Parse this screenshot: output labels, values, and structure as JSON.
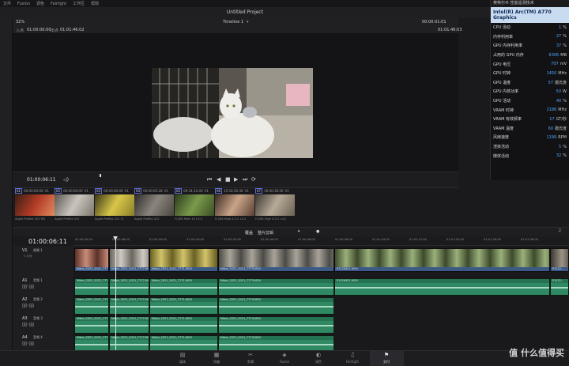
{
  "menubar": {
    "items": [
      "文件",
      "Fusion",
      "调色",
      "Fairlight",
      "工作区",
      "帮助"
    ]
  },
  "window": {
    "title": "Untitled Project"
  },
  "viewer_header": {
    "zoom": "32%",
    "timeline_name": "Timeline 1",
    "src_label": "入点",
    "src_tc": "01:00:00:00",
    "out_label": "出点",
    "out_tc": "01:01:46:02",
    "duration_tc": "00:00:01:01",
    "right_tc": "01:01:46:03"
  },
  "transport": {
    "timecode": "01:00:06:11",
    "controls": [
      "⏮",
      "◀",
      "■",
      "▶",
      "⏭",
      "⟳"
    ]
  },
  "clips": [
    {
      "num": "01",
      "tc": "00:00:00:00",
      "track": "V1",
      "label": "Apple ProRes 422 HQ",
      "colors": [
        "#3b1d16",
        "#b23b26",
        "#e28a5f"
      ]
    },
    {
      "num": "02",
      "tc": "00:00:00:00",
      "track": "V1",
      "label": "Apple ProRes 422",
      "colors": [
        "#5a5752",
        "#c9c5bd",
        "#7b766e"
      ]
    },
    {
      "num": "03",
      "tc": "00:00:00:00",
      "track": "V1",
      "label": "Apple ProRes 422 LT",
      "colors": [
        "#3a3616",
        "#d8c64a",
        "#8b7f2a"
      ]
    },
    {
      "num": "04",
      "tc": "00:00:05:28",
      "track": "V1",
      "label": "Apple ProRes 422",
      "colors": [
        "#2c2b29",
        "#8a857c",
        "#4a4741"
      ]
    },
    {
      "num": "05",
      "tc": "09:34:12:46",
      "track": "V1",
      "label": "H.265 Main 10 L5.2",
      "colors": [
        "#2c3a1c",
        "#7a9a4a",
        "#3c4e24"
      ]
    },
    {
      "num": "06",
      "tc": "15:54:56:36",
      "track": "V1",
      "label": "H.264 High 4:2:2 L4.2",
      "colors": [
        "#3a2a22",
        "#c9a488",
        "#5a4034"
      ]
    },
    {
      "num": "07",
      "tc": "16:00:36:26",
      "track": "V1",
      "label": "H.264 High 4:2:2 L4.2",
      "colors": [
        "#3c3833",
        "#b7aa97",
        "#6a6154"
      ]
    }
  ],
  "timeline": {
    "timecode": "01:00:06:11",
    "mode_label": "覆盖",
    "mode_value": "整片剪辑",
    "ruler_marks": [
      "01:00:00:00",
      "01:00:08:00",
      "01:00:16:00",
      "01:00:24:00",
      "01:00:32:00",
      "01:00:40:00",
      "01:00:48:00",
      "01:00:56:00",
      "01:01:04:00",
      "01:01:12:00",
      "01:01:20:00",
      "01:01:28:00",
      "01:01:36:00"
    ],
    "tracks": [
      {
        "id": "V1",
        "name": "视频 1",
        "sub": "5 片段"
      },
      {
        "id": "A1",
        "name": "音频 1",
        "sub": "2.0"
      },
      {
        "id": "A2",
        "name": "音频 2",
        "sub": "2.0"
      },
      {
        "id": "A3",
        "name": "音频 3",
        "sub": "2.0"
      },
      {
        "id": "A4",
        "name": "音频 4",
        "sub": "2.0"
      }
    ],
    "video_clips": [
      {
        "name": "Nikon_2021_2021_7770.MOV",
        "colors": [
          "#5a3128",
          "#c98c7a"
        ]
      },
      {
        "name": "Nikon_2021_2021_7777.MOV",
        "colors": [
          "#6b6760",
          "#cfcac2"
        ]
      },
      {
        "name": "Nikon_2021_2021_7771.MOV",
        "colors": [
          "#6a6124",
          "#d2c46a"
        ]
      },
      {
        "name": "Nikon_2021_2021_7773.MOV",
        "colors": [
          "#4c4a46",
          "#a9a49a"
        ]
      },
      {
        "name": "P1129421.MOV",
        "colors": [
          "#3d4a2c",
          "#9ab07a"
        ]
      },
      {
        "name": "P1122...",
        "colors": [
          "#3c3833",
          "#9e9385"
        ]
      }
    ],
    "audio_clips": [
      [
        "Nikon_2021_2021_7770.MOV",
        "Nikon_2021_2021_7777.MOV",
        "Nikon_2021_2021_7771.MOV",
        "Nikon_2021_2021_7773.MOV",
        "P1129421.MOV",
        "P1122..."
      ],
      [
        "Nikon_2021_2021_7770.MOV",
        "Nikon_2021_2021_7777.MOV",
        "Nikon_2021_2021_7771.MOV",
        "Nikon_2021_2021_7773.MOV"
      ],
      [
        "Nikon_2021_2021_7770.MOV",
        "Nikon_2021_2021_7777.MOV",
        "Nikon_2021_2021_7771.MOV",
        "Nikon_2021_2021_7773.MOV"
      ],
      [
        "Nikon_2021_2021_7770.MOV",
        "Nikon_2021_2021_7777.MOV",
        "Nikon_2021_2021_7771.MOV",
        "Nikon_2021_2021_7773.MOV"
      ]
    ]
  },
  "pages": [
    {
      "label": "媒体",
      "icon": "▤"
    },
    {
      "label": "快编",
      "icon": "▦"
    },
    {
      "label": "剪辑",
      "icon": "✂"
    },
    {
      "label": "Fusion",
      "icon": "◈"
    },
    {
      "label": "调色",
      "icon": "◐"
    },
    {
      "label": "Fairlight",
      "icon": "♫"
    },
    {
      "label": "交付",
      "icon": "⚑"
    }
  ],
  "active_page": "交付",
  "monitor": {
    "top": "英特尔® 性能遥测技术",
    "device": "Intel(R) Arc(TM) A770 Graphics",
    "rows": [
      {
        "label": "CPU 活动",
        "value": "1",
        "unit": "%"
      },
      {
        "label": "内存利用率",
        "value": "27",
        "unit": "%"
      },
      {
        "label": "GPU 内存利用率",
        "value": "37",
        "unit": "%"
      },
      {
        "label": "占用的 GPU 内存",
        "value": "6306",
        "unit": "MB"
      },
      {
        "label": "GPU 电压",
        "value": "707",
        "unit": "mV"
      },
      {
        "label": "GPU 时钟",
        "value": "1450",
        "unit": "MHz"
      },
      {
        "label": "GPU 温度",
        "value": "57",
        "unit": "摄氏度"
      },
      {
        "label": "GPU 内核功率",
        "value": "50",
        "unit": "W"
      },
      {
        "label": "GPU 活动",
        "value": "40",
        "unit": "%"
      },
      {
        "label": "VRAM 时钟",
        "value": "2186",
        "unit": "MHz"
      },
      {
        "label": "VRAM 有效频率",
        "value": "17",
        "unit": "GT/秒"
      },
      {
        "label": "VRAM 温度",
        "value": "60",
        "unit": "摄氏度"
      },
      {
        "label": "风扇速度",
        "value": "1199",
        "unit": "RPM"
      },
      {
        "label": "渲染活动",
        "value": "5",
        "unit": "%"
      },
      {
        "label": "媒体活动",
        "value": "32",
        "unit": "%"
      }
    ]
  },
  "watermark": "值 什么值得买"
}
